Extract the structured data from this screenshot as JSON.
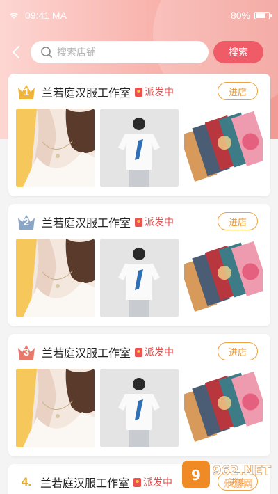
{
  "status": {
    "time": "09:41 MA",
    "battery": "80%",
    "battery_level": 0.8
  },
  "search": {
    "placeholder": "搜索店铺",
    "button_label": "搜索"
  },
  "shops": [
    {
      "rank": "1",
      "name": "兰若庭汉服工作室",
      "tag": "派发中",
      "enter_label": "进店",
      "crown_color": "#f0b43a"
    },
    {
      "rank": "2",
      "name": "兰若庭汉服工作室",
      "tag": "派发中",
      "enter_label": "进店",
      "crown_color": "#8aa6c7"
    },
    {
      "rank": "3",
      "name": "兰若庭汉服工作室",
      "tag": "派发中",
      "enter_label": "进店",
      "crown_color": "#e87a6c"
    },
    {
      "rank": "4.",
      "name": "兰若庭汉服工作室",
      "tag": "派发中",
      "enter_label": "进店"
    }
  ],
  "colors": {
    "accent": "#ef5c68",
    "enter_border": "#f0a23a",
    "dispatch_red": "#e84d4d"
  },
  "watermark": {
    "text": "962.NET 乐游网"
  }
}
